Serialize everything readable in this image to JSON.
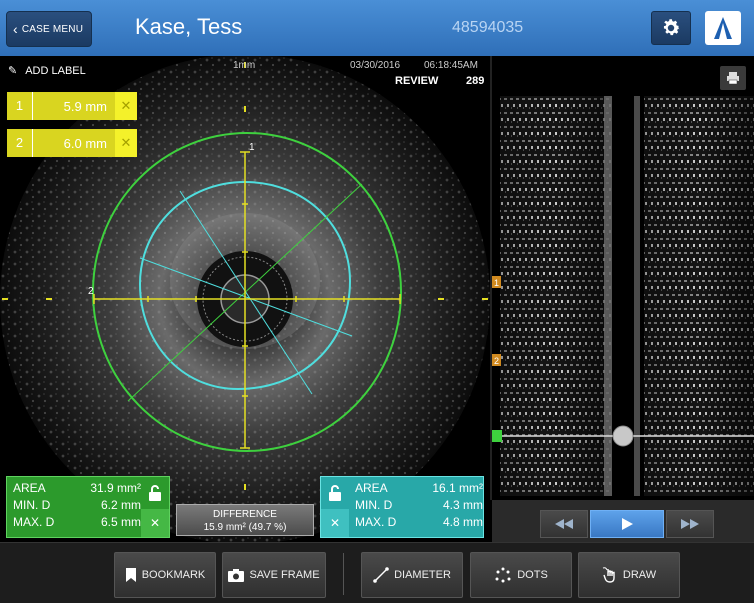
{
  "header": {
    "case_menu_label": "CASE MENU",
    "patient_name": "Kase, Tess",
    "patient_id": "48594035"
  },
  "image_view": {
    "add_label": "ADD LABEL",
    "scale": "1mm",
    "date": "03/30/2016",
    "time": "06:18:45AM",
    "mode": "REVIEW",
    "frame": "289",
    "marker_1": "1",
    "marker_2": "2"
  },
  "measurements": [
    {
      "num": "1",
      "value": "5.9 mm",
      "remove": "✕"
    },
    {
      "num": "2",
      "value": "6.0 mm",
      "remove": "✕"
    }
  ],
  "vessel_stats": {
    "area_label": "AREA",
    "area_value": "31.9 mm²",
    "min_label": "MIN. D",
    "min_value": "6.2 mm",
    "max_label": "MAX. D",
    "max_value": "6.5 mm",
    "remove": "✕"
  },
  "lumen_stats": {
    "area_label": "AREA",
    "area_value": "16.1 mm²",
    "min_label": "MIN. D",
    "min_value": "4.3 mm",
    "max_label": "MAX. D",
    "max_value": "4.8 mm",
    "remove": "✕"
  },
  "difference": {
    "label": "DIFFERENCE",
    "value": "15.9 mm² (49.7 %)"
  },
  "longitudinal": {
    "marker_1": "1",
    "marker_2": "2",
    "slider_position": 0.5
  },
  "toolbar": {
    "bookmark": "BOOKMARK",
    "save_frame": "SAVE FRAME",
    "diameter": "DIAMETER",
    "dots": "DOTS",
    "draw": "DRAW"
  },
  "colors": {
    "header": "#3a7fc8",
    "vessel": "#3ed13e",
    "lumen": "#4fdede",
    "measure": "#e4df22",
    "play": "#4a90e2"
  }
}
